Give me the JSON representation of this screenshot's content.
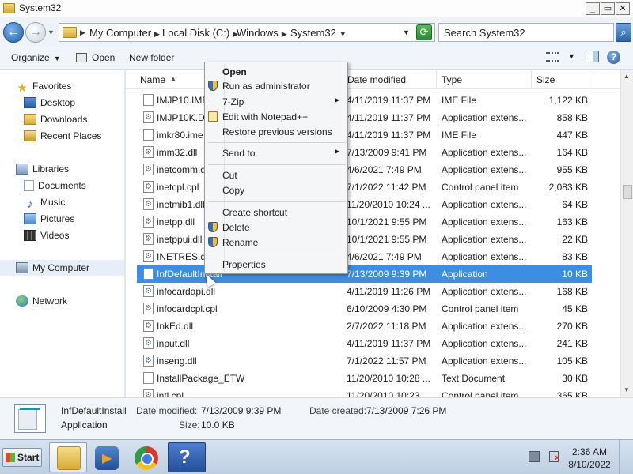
{
  "window": {
    "title": "System32"
  },
  "address": {
    "crumbs": [
      "My Computer",
      "Local Disk (C:)",
      "Windows",
      "System32"
    ],
    "search_placeholder": "Search System32"
  },
  "toolbar": {
    "organize": "Organize",
    "open": "Open",
    "new_folder": "New folder"
  },
  "nav": {
    "favorites": "Favorites",
    "desktop": "Desktop",
    "downloads": "Downloads",
    "recent": "Recent Places",
    "libraries": "Libraries",
    "documents": "Documents",
    "music": "Music",
    "pictures": "Pictures",
    "videos": "Videos",
    "computer": "My Computer",
    "network": "Network"
  },
  "columns": {
    "name": "Name",
    "date": "Date modified",
    "type": "Type",
    "size": "Size"
  },
  "files": [
    {
      "name": "IMJP10.IME",
      "date": "4/11/2019 11:37 PM",
      "type": "IME File",
      "size": "1,122 KB",
      "icon": "blank"
    },
    {
      "name": "IMJP10K.DLL",
      "date": "4/11/2019 11:37 PM",
      "type": "Application extens...",
      "size": "858 KB",
      "icon": "gear"
    },
    {
      "name": "imkr80.ime",
      "date": "4/11/2019 11:37 PM",
      "type": "IME File",
      "size": "447 KB",
      "icon": "blank"
    },
    {
      "name": "imm32.dll",
      "date": "7/13/2009 9:41 PM",
      "type": "Application extens...",
      "size": "164 KB",
      "icon": "gear"
    },
    {
      "name": "inetcomm.dll",
      "date": "4/6/2021 7:49 PM",
      "type": "Application extens...",
      "size": "955 KB",
      "icon": "gear"
    },
    {
      "name": "inetcpl.cpl",
      "date": "7/1/2022 11:42 PM",
      "type": "Control panel item",
      "size": "2,083 KB",
      "icon": "gear"
    },
    {
      "name": "inetmib1.dll",
      "date": "11/20/2010 10:24 ...",
      "type": "Application extens...",
      "size": "64 KB",
      "icon": "gear"
    },
    {
      "name": "inetpp.dll",
      "date": "10/1/2021 9:55 PM",
      "type": "Application extens...",
      "size": "163 KB",
      "icon": "gear"
    },
    {
      "name": "inetppui.dll",
      "date": "10/1/2021 9:55 PM",
      "type": "Application extens...",
      "size": "22 KB",
      "icon": "gear"
    },
    {
      "name": "INETRES.dll",
      "date": "4/6/2021 7:49 PM",
      "type": "Application extens...",
      "size": "83 KB",
      "icon": "gear"
    },
    {
      "name": "InfDefaultInstall",
      "date": "7/13/2009 9:39 PM",
      "type": "Application",
      "size": "10 KB",
      "icon": "app",
      "selected": true
    },
    {
      "name": "infocardapi.dll",
      "date": "4/11/2019 11:26 PM",
      "type": "Application extens...",
      "size": "168 KB",
      "icon": "gear"
    },
    {
      "name": "infocardcpl.cpl",
      "date": "6/10/2009 4:30 PM",
      "type": "Control panel item",
      "size": "45 KB",
      "icon": "gear"
    },
    {
      "name": "InkEd.dll",
      "date": "2/7/2022 11:18 PM",
      "type": "Application extens...",
      "size": "270 KB",
      "icon": "gear"
    },
    {
      "name": "input.dll",
      "date": "4/11/2019 11:37 PM",
      "type": "Application extens...",
      "size": "241 KB",
      "icon": "gear"
    },
    {
      "name": "inseng.dll",
      "date": "7/1/2022 11:57 PM",
      "type": "Application extens...",
      "size": "105 KB",
      "icon": "gear"
    },
    {
      "name": "InstallPackage_ETW",
      "date": "11/20/2010 10:28 ...",
      "type": "Text Document",
      "size": "30 KB",
      "icon": "blank"
    },
    {
      "name": "intl.cpl",
      "date": "11/20/2010 10:23 ...",
      "type": "Control panel item",
      "size": "365 KB",
      "icon": "gear"
    }
  ],
  "context_menu": {
    "open": "Open",
    "run_admin": "Run as administrator",
    "zip": "7-Zip",
    "notepad": "Edit with Notepad++",
    "restore": "Restore previous versions",
    "send_to": "Send to",
    "cut": "Cut",
    "copy": "Copy",
    "shortcut": "Create shortcut",
    "delete": "Delete",
    "rename": "Rename",
    "properties": "Properties"
  },
  "details": {
    "name": "InfDefaultInstall",
    "type": "Application",
    "modified_label": "Date modified:",
    "modified": "7/13/2009 9:39 PM",
    "created_label": "Date created:",
    "created": "7/13/2009 7:26 PM",
    "size_label": "Size:",
    "size": "10.0 KB"
  },
  "taskbar": {
    "start": "Start",
    "time": "2:36 AM",
    "date": "8/10/2022"
  }
}
